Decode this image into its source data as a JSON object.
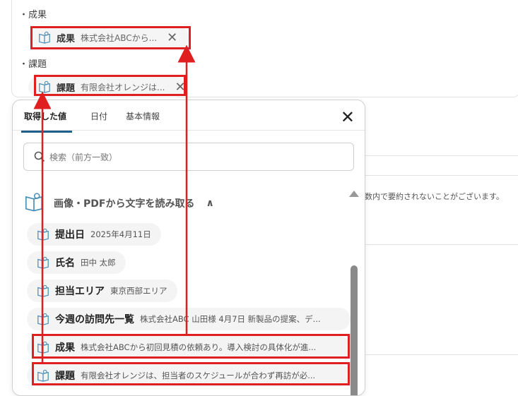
{
  "form": {
    "section1_label": "・成果",
    "section2_label": "・課題",
    "chip1": {
      "name": "成果",
      "value": "株式会社ABCから..."
    },
    "chip2": {
      "name": "課題",
      "value": "有限会社オレンジは..."
    },
    "close_glyph": "✕"
  },
  "right_note": "数内で要約されないことがございます。",
  "popup": {
    "tabs": [
      "取得した値",
      "日付",
      "基本情報"
    ],
    "close_glyph": "✕",
    "search_placeholder": "検索（前方一致）",
    "group_title": "画像・PDFから文字を読み取る",
    "group_chevron": "∧",
    "items": [
      {
        "name": "提出日",
        "value": "2025年4月11日"
      },
      {
        "name": "氏名",
        "value": "田中 太郎"
      },
      {
        "name": "担当エリア",
        "value": "東京西部エリア"
      },
      {
        "name": "今週の訪問先一覧",
        "value": "株式会社ABC 山田様 4月7日 新製品の提案、デ..."
      },
      {
        "name": "成果",
        "value": "株式会社ABCから初回見積の依頼あり。導入検討の具体化が進..."
      },
      {
        "name": "課題",
        "value": "有限会社オレンジは、担当者のスケジュールが合わず再訪が必..."
      }
    ]
  },
  "colors": {
    "highlight": "#e02020",
    "tab_underline": "#1f5f8b"
  }
}
